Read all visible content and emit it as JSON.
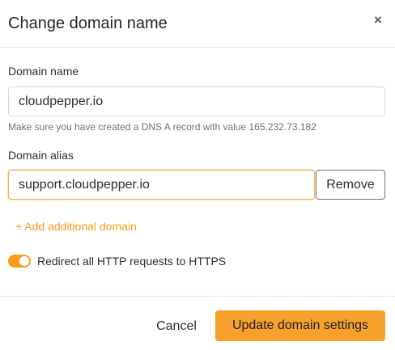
{
  "dialog": {
    "title": "Change domain name",
    "close_glyph": "×",
    "close_icon": "close-icon"
  },
  "domain_name": {
    "label": "Domain name",
    "value": "cloudpepper.io",
    "help": "Make sure you have created a DNS A record with value 165.232.73.182"
  },
  "domain_alias": {
    "label": "Domain alias",
    "value": "support.cloudpepper.io",
    "remove_label": "Remove"
  },
  "add_domain": {
    "label": "+ Add additional domain"
  },
  "redirect": {
    "label": "Redirect all HTTP requests to HTTPS",
    "enabled": true
  },
  "footer": {
    "cancel_label": "Cancel",
    "submit_label": "Update domain settings"
  },
  "colors": {
    "accent": "#f7a02c",
    "link": "#f59c1a",
    "focus_border": "#f2b254"
  }
}
